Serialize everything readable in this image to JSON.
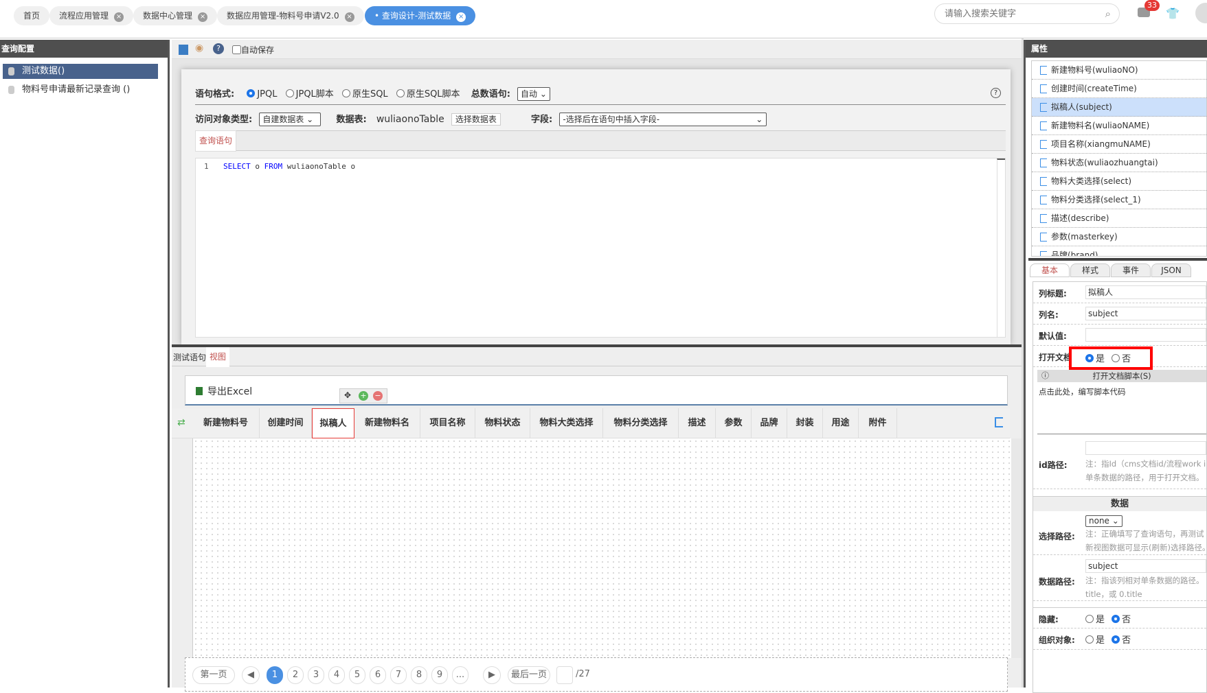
{
  "tabs": [
    {
      "label": "首页"
    },
    {
      "label": "流程应用管理"
    },
    {
      "label": "数据中心管理"
    },
    {
      "label": "数据应用管理-物料号申请V2.0"
    },
    {
      "label": "查询设计-测试数据",
      "active": true
    }
  ],
  "search": {
    "placeholder": "请输入搜索关键字"
  },
  "notifications": {
    "count": "33"
  },
  "left": {
    "title": "查询配置",
    "items": [
      {
        "label": "测试数据()"
      },
      {
        "label": "物料号申请最新记录查询 ()"
      }
    ]
  },
  "toolbar": {
    "autosave": "自动保存"
  },
  "editor": {
    "format_label": "语句格式:",
    "formats": [
      "JPQL",
      "JPQL脚本",
      "原生SQL",
      "原生SQL脚本"
    ],
    "count_label": "总数语句:",
    "count_value": "自动",
    "access_label": "访问对象类型:",
    "access_value": "自建数据表",
    "table_label": "数据表:",
    "table_value": "wuliaonoTable",
    "choose_table": "选择数据表",
    "field_label": "字段:",
    "field_value": "-选择后在语句中插入字段-",
    "query_tab": "查询语句",
    "line_no": "1",
    "code": {
      "kw1": "SELECT",
      "t1": " o ",
      "kw2": "FROM",
      "t2": " wuliaonoTable o"
    }
  },
  "bottom": {
    "tabs": [
      "测试语句",
      "视图"
    ],
    "export": "导出Excel",
    "columns": [
      "新建物料号",
      "创建时间",
      "拟稿人",
      "新建物料名",
      "项目名称",
      "物料状态",
      "物料大类选择",
      "物料分类选择",
      "描述",
      "参数",
      "品牌",
      "封装",
      "用途",
      "附件"
    ],
    "pagination": {
      "first": "第一页",
      "pages": [
        "1",
        "2",
        "3",
        "4",
        "5",
        "6",
        "7",
        "8",
        "9",
        "..."
      ],
      "last": "最后一页",
      "total": "/27",
      "current": "1"
    }
  },
  "right": {
    "title": "属性",
    "fields": [
      "新建物料号(wuliaoNO)",
      "创建时间(createTime)",
      "拟稿人(subject)",
      "新建物料名(wuliaoNAME)",
      "项目名称(xiangmuNAME)",
      "物料状态(wuliaozhuangtai)",
      "物料大类选择(select)",
      "物料分类选择(select_1)",
      "描述(describe)",
      "参数(masterkey)",
      "品牌(brand)"
    ],
    "tabs": [
      "基本",
      "样式",
      "事件",
      "JSON"
    ],
    "props": {
      "col_title_label": "列标题:",
      "col_title": "拟稿人",
      "col_name_label": "列名:",
      "col_name": "subject",
      "default_label": "默认值:",
      "open_doc_label": "打开文档",
      "yes": "是",
      "no": "否",
      "script_header": "打开文档脚本(S)",
      "script_hint": "点击此处，编写脚本代码",
      "id_path_label": "id路径:",
      "id_note1": "注：指Id（cms文档id/流程work i",
      "id_note2": "单条数据的路径，用于打开文档。",
      "data_section": "数据",
      "select_path_label": "选择路径:",
      "select_path": "none",
      "sp_note1": "注：正确填写了查询语句，再测试",
      "sp_note2": "新视图数据可显示(刷新)选择路径。",
      "data_path_label": "数据路径:",
      "data_path": "subject",
      "dp_note1": "注：指该列相对单条数据的路径。",
      "dp_note2": "title，或 0.title",
      "hidden_label": "隐藏:",
      "org_label": "组织对象:"
    }
  }
}
